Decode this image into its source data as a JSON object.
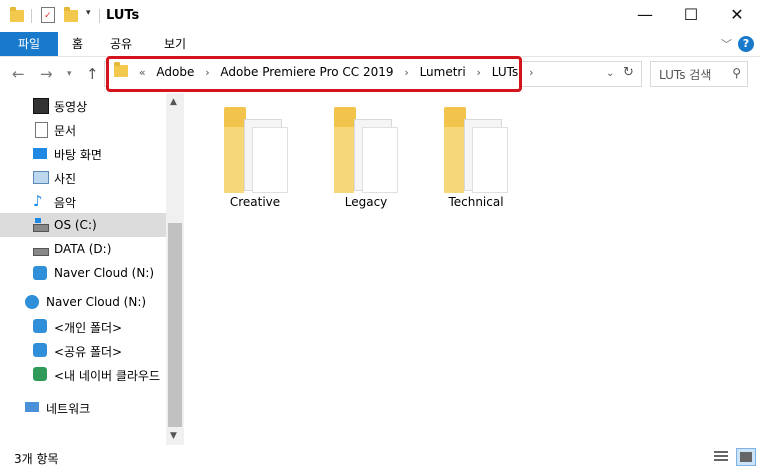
{
  "window": {
    "title": "LUTs",
    "controls": {
      "minimize": "—",
      "maximize": "☐",
      "close": "✕"
    }
  },
  "ribbon": {
    "tabs": [
      "파일",
      "홈",
      "공유",
      "보기"
    ],
    "help_label": "?"
  },
  "breadcrumb": {
    "overflow": "«",
    "items": [
      "Adobe",
      "Adobe Premiere Pro CC 2019",
      "Lumetri",
      "LUTs"
    ]
  },
  "search": {
    "placeholder": "LUTs 검색"
  },
  "sidebar": {
    "items": [
      {
        "label": "동영상",
        "icon": "video-icon"
      },
      {
        "label": "문서",
        "icon": "document-icon"
      },
      {
        "label": "바탕 화면",
        "icon": "desktop-icon"
      },
      {
        "label": "사진",
        "icon": "picture-icon"
      },
      {
        "label": "음악",
        "icon": "music-icon"
      },
      {
        "label": "OS (C:)",
        "icon": "drive-icon",
        "selected": true
      },
      {
        "label": "DATA (D:)",
        "icon": "drive-icon"
      },
      {
        "label": "Naver Cloud (N:)",
        "icon": "cloud-drive-icon"
      },
      {
        "label": "Naver Cloud (N:)",
        "icon": "cloud-icon"
      },
      {
        "label": "<개인 폴더>",
        "icon": "cloud-folder-icon"
      },
      {
        "label": "<공유 폴더>",
        "icon": "cloud-folder-icon"
      },
      {
        "label": "<내 네이버 클라우드",
        "icon": "cloud-folder-icon"
      },
      {
        "label": "네트워크",
        "icon": "network-icon"
      }
    ]
  },
  "folders": [
    {
      "name": "Creative"
    },
    {
      "name": "Legacy"
    },
    {
      "name": "Technical"
    }
  ],
  "status": {
    "item_count": "3개 항목"
  },
  "colors": {
    "accent": "#1979ca",
    "highlight": "#d3141c",
    "folder": "#f3c44b"
  }
}
